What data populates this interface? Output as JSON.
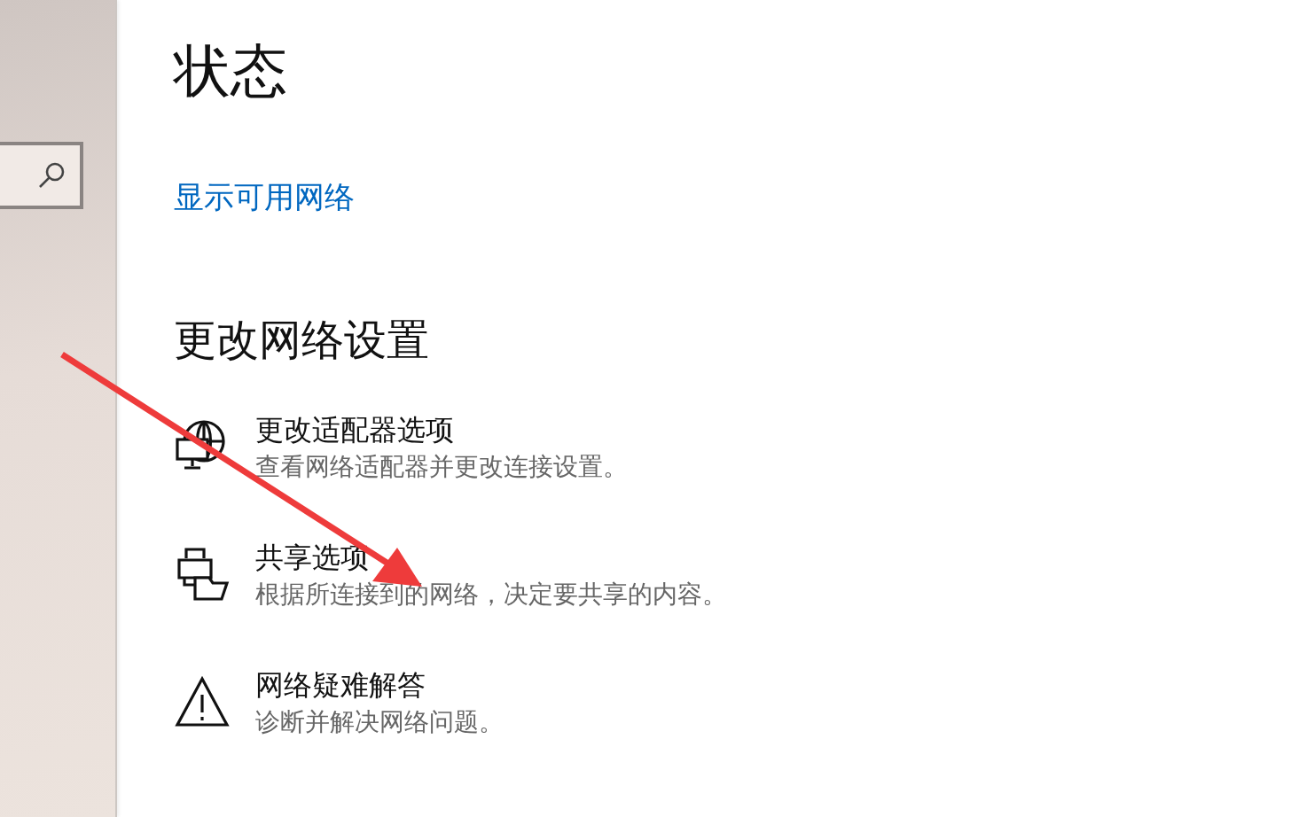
{
  "sidebar": {
    "search": {
      "kind": "search-field"
    }
  },
  "page": {
    "title": "状态",
    "link": "显示可用网络",
    "section_title": "更改网络设置",
    "items": [
      {
        "kind": "adapter",
        "title": "更改适配器选项",
        "description": "查看网络适配器并更改连接设置。"
      },
      {
        "kind": "sharing",
        "title": "共享选项",
        "description": "根据所连接到的网络，决定要共享的内容。"
      },
      {
        "kind": "troubleshoot",
        "title": "网络疑难解答",
        "description": "诊断并解决网络问题。"
      }
    ]
  }
}
